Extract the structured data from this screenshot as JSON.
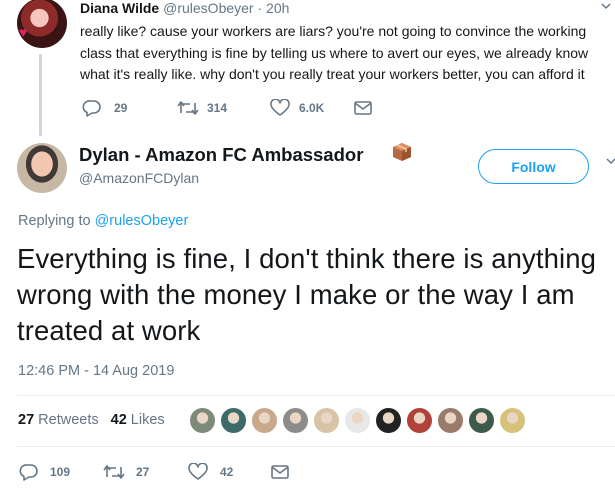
{
  "reply_tweet": {
    "name": "Diana Wilde",
    "handle": "@rulesObeyer",
    "separator": "·",
    "time": "20h",
    "text_lines": [
      "really like? cause your workers are liars? you're not going to convince the working",
      "class that everything is fine by telling us where to avert our eyes, we already know",
      "what it's really like. why don't you really treat your workers better, you can afford it"
    ],
    "actions": {
      "reply_count": "29",
      "retweet_count": "314",
      "like_count": "6.0K"
    }
  },
  "main_tweet": {
    "name": "Dylan - Amazon FC Ambassador",
    "handle": "@AmazonFCDylan",
    "follow_label": "Follow",
    "replying_prefix": "Replying to",
    "replying_handle": "@rulesObeyer",
    "text": "Everything is fine, I don't think there is anything wrong with the money I make or the way I am treated at work",
    "timestamp": "12:46 PM - 14 Aug 2019",
    "stats": {
      "retweets_count": "27",
      "retweets_label": "Retweets",
      "likes_count": "42",
      "likes_label": "Likes"
    },
    "liker_avatar_colors": [
      "#7d8a7a",
      "#3c6b6a",
      "#c9a98a",
      "#8c8c8c",
      "#d7c3a5",
      "#e8e8e8",
      "#222222",
      "#b0423a",
      "#9a7b6b",
      "#3d5a4d",
      "#d6c27a"
    ],
    "actions": {
      "reply_count": "109",
      "retweet_count": "27",
      "like_count": "42"
    }
  },
  "colors": {
    "accent": "#1da1f2",
    "secondary_text": "#657786",
    "primary_text": "#14171a",
    "divider": "#e6ecf0"
  },
  "icons": [
    "reply-icon",
    "retweet-icon",
    "heart-icon",
    "mail-icon",
    "chevron-down-icon",
    "package-box-icon"
  ]
}
